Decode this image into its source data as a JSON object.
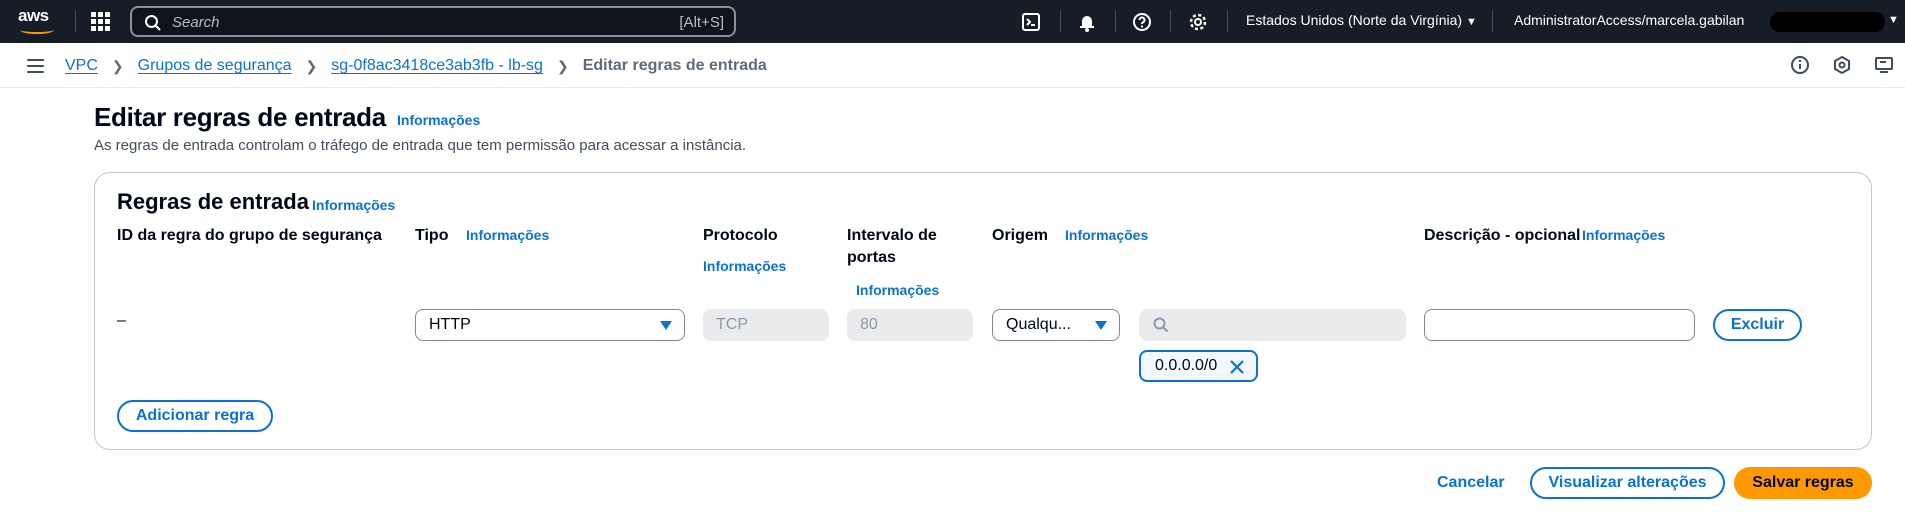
{
  "topbar": {
    "logo_text": "aws",
    "search_placeholder": "Search",
    "search_shortcut": "[Alt+S]",
    "region": "Estados Unidos (Norte da Virgínia)",
    "account": "AdministratorAccess/marcela.gabilan"
  },
  "breadcrumb": {
    "items": [
      "VPC",
      "Grupos de segurança",
      "sg-0f8ac3418ce3ab3fb - lb-sg"
    ],
    "current": "Editar regras de entrada"
  },
  "header": {
    "title": "Editar regras de entrada",
    "info": "Informações",
    "description": "As regras de entrada controlam o tráfego de entrada que tem permissão para acessar a instância."
  },
  "panel": {
    "title": "Regras de entrada",
    "info": "Informações",
    "columns": {
      "rule_id": "ID da regra do grupo de segurança",
      "type": "Tipo",
      "protocol": "Protocolo",
      "port_range_line1": "Intervalo de",
      "port_range_line2": "portas",
      "source": "Origem",
      "description": "Descrição - opcional"
    },
    "info_label": "Informações",
    "rule": {
      "id": "–",
      "type": "HTTP",
      "protocol": "TCP",
      "port_range": "80",
      "source": "Qualqu...",
      "cidr_token": "0.0.0.0/0",
      "description_value": ""
    },
    "delete_button": "Excluir",
    "add_rule_button": "Adicionar regra"
  },
  "footer": {
    "cancel": "Cancelar",
    "preview": "Visualizar alterações",
    "save": "Salvar regras"
  },
  "colors": {
    "link": "#0972d3",
    "primary_button": "#ff9900",
    "topbar_bg": "#161d26"
  }
}
